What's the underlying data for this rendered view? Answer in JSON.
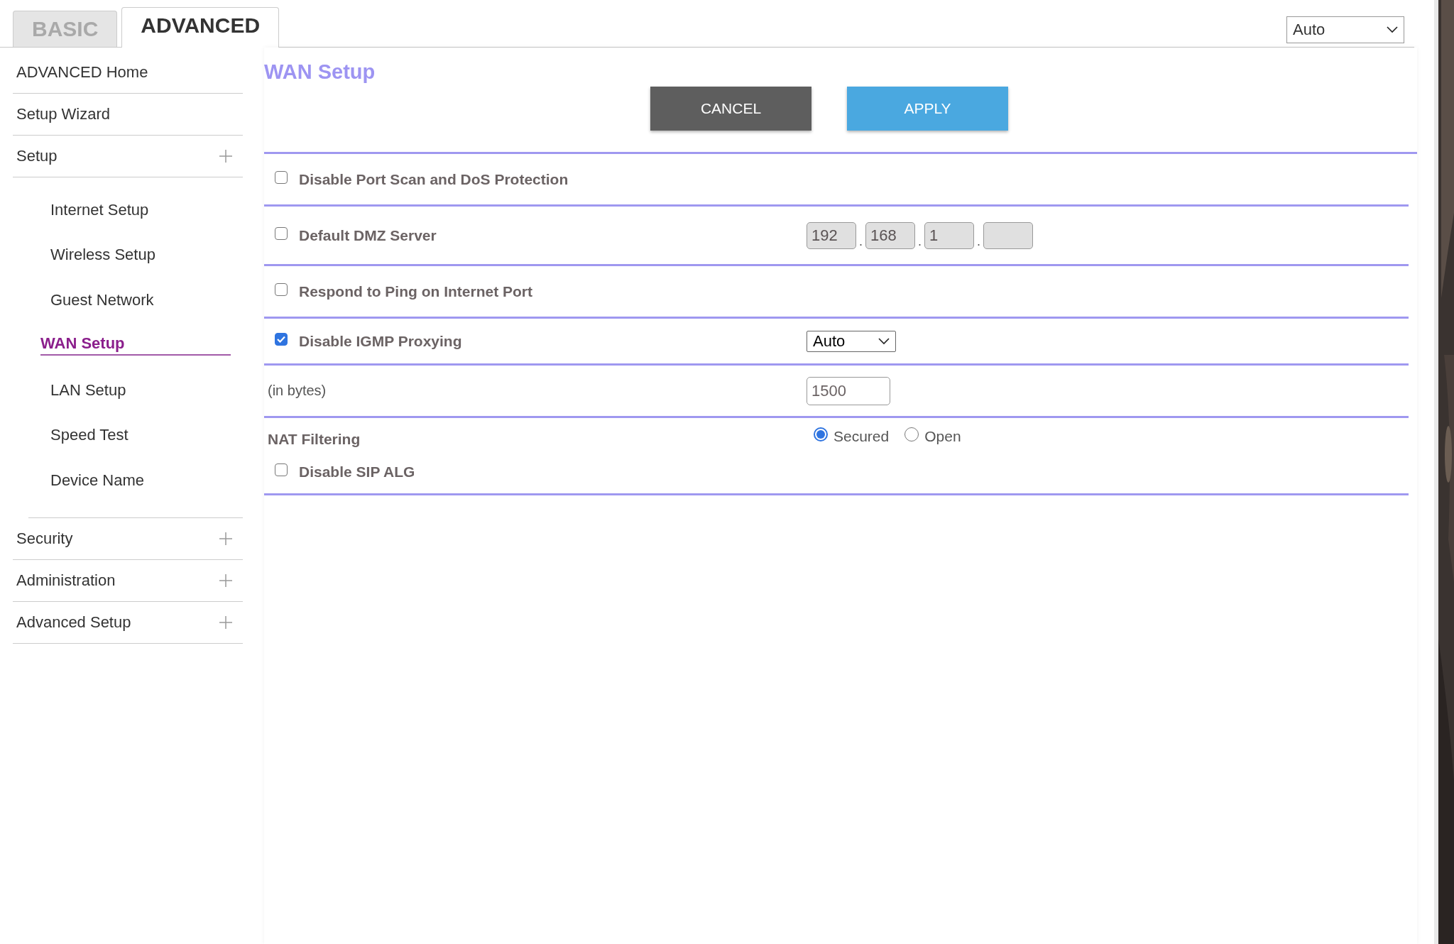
{
  "tabs": [
    {
      "label": "BASIC",
      "selected": false
    },
    {
      "label": "ADVANCED",
      "selected": true
    }
  ],
  "language_select": {
    "value": "Auto"
  },
  "sidebar": {
    "items": [
      {
        "label": "ADVANCED Home",
        "kind": "link"
      },
      {
        "label": "Setup Wizard",
        "kind": "link"
      },
      {
        "label": "Setup",
        "kind": "group",
        "children": [
          {
            "label": "Internet Setup",
            "selected": false
          },
          {
            "label": "Wireless Setup",
            "selected": false
          },
          {
            "label": "Guest Network",
            "selected": false
          },
          {
            "label": "WAN Setup",
            "selected": true
          },
          {
            "label": "LAN Setup",
            "selected": false
          },
          {
            "label": "Speed Test",
            "selected": false
          },
          {
            "label": "Device Name",
            "selected": false
          }
        ]
      },
      {
        "label": "Security",
        "kind": "group"
      },
      {
        "label": "Administration",
        "kind": "group"
      },
      {
        "label": "Advanced Setup",
        "kind": "group"
      }
    ]
  },
  "content": {
    "title": "WAN Setup",
    "buttons": [
      {
        "label": "CANCEL",
        "kind": "secondary"
      },
      {
        "label": "APPLY",
        "kind": "primary"
      }
    ],
    "rows": [
      {
        "kind": "checkbox",
        "label": "Disable Port Scan and DoS Protection",
        "checked": false
      },
      {
        "kind": "checkbox",
        "label": "Default DMZ Server",
        "checked": false,
        "ip_separator": ".",
        "ip_fields": [
          {
            "value": "192",
            "disabled": true
          },
          {
            "value": "168",
            "disabled": true
          },
          {
            "value": "1",
            "disabled": true
          },
          {
            "disabled": true
          }
        ]
      },
      {
        "kind": "checkbox",
        "label": "Respond to Ping on Internet Port",
        "checked": false
      },
      {
        "kind": "checkbox",
        "label": "Disable IGMP Proxying",
        "checked": true,
        "select": {
          "value": "Auto"
        }
      },
      {
        "kind": "text",
        "label": "(in bytes)",
        "input": {
          "value": "1500"
        }
      },
      {
        "kind": "nat",
        "label": "NAT Filtering",
        "options": [
          {
            "label": "Secured",
            "selected": true
          },
          {
            "label": "Open",
            "selected": false
          }
        ],
        "sub_checkbox": {
          "label": "Disable SIP ALG",
          "checked": false
        }
      }
    ]
  }
}
